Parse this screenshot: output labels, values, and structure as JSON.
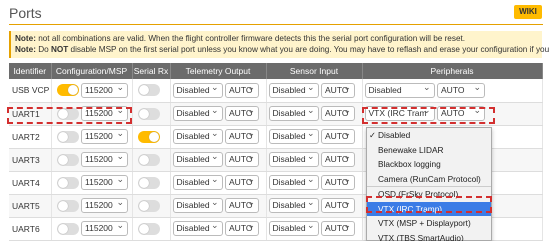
{
  "header": {
    "title": "Ports",
    "wiki_label": "WIKI"
  },
  "note": {
    "line1_label": "Note:",
    "line1_text": " not all combinations are valid. When the flight controller firmware detects this the serial port configuration will be reset.",
    "line2_label": "Note:",
    "line2_pre": " Do ",
    "line2_not": "NOT",
    "line2_post": " disable MSP on the first serial port unless you know what you are doing. You may have to reflash and erase your configuration if you do."
  },
  "table": {
    "headers": [
      "Identifier",
      "Configuration/MSP",
      "Serial Rx",
      "Telemetry Output",
      "Sensor Input",
      "Peripherals"
    ],
    "rows": [
      {
        "id": "USB VCP",
        "msp_on": true,
        "baud": "115200",
        "rx_on": false,
        "tele": "Disabled",
        "tele_rate": "AUTO",
        "sensor": "Disabled",
        "sensor_rate": "AUTO",
        "periph": "Disabled",
        "periph_rate": "AUTO"
      },
      {
        "id": "UART1",
        "msp_on": false,
        "baud": "115200",
        "rx_on": false,
        "tele": "Disabled",
        "tele_rate": "AUTO",
        "sensor": "Disabled",
        "sensor_rate": "AUTO",
        "periph": "VTX (IRC Tram",
        "periph_rate": "AUTO"
      },
      {
        "id": "UART2",
        "msp_on": false,
        "baud": "115200",
        "rx_on": true,
        "tele": "Disabled",
        "tele_rate": "AUTO",
        "sensor": "Disabled",
        "sensor_rate": "AUTO"
      },
      {
        "id": "UART3",
        "msp_on": false,
        "baud": "115200",
        "rx_on": false,
        "tele": "Disabled",
        "tele_rate": "AUTO",
        "sensor": "Disabled",
        "sensor_rate": "AUTO"
      },
      {
        "id": "UART4",
        "msp_on": false,
        "baud": "115200",
        "rx_on": false,
        "tele": "Disabled",
        "tele_rate": "AUTO",
        "sensor": "Disabled",
        "sensor_rate": "AUTO"
      },
      {
        "id": "UART5",
        "msp_on": false,
        "baud": "115200",
        "rx_on": false,
        "tele": "Disabled",
        "tele_rate": "AUTO",
        "sensor": "Disabled",
        "sensor_rate": "AUTO"
      },
      {
        "id": "UART6",
        "msp_on": false,
        "baud": "115200",
        "rx_on": false,
        "tele": "Disabled",
        "tele_rate": "AUTO",
        "sensor": "Disabled",
        "sensor_rate": "AUTO"
      }
    ]
  },
  "peripherals_dropdown": {
    "options": [
      "Disabled",
      "Benewake LIDAR",
      "Blackbox logging",
      "Camera (RunCam Protocol)",
      "OSD (FrSky Protocol)",
      "VTX (IRC Tramp)",
      "VTX (MSP + Displayport)",
      "VTX (TBS SmartAudio)"
    ],
    "checked": "Disabled",
    "highlighted": "VTX (IRC Tramp)"
  },
  "colors": {
    "accent": "#ffbb00",
    "highlight": "#3b7ce6",
    "callout": "#d32f2f",
    "header_bg": "#6b6b6b"
  }
}
